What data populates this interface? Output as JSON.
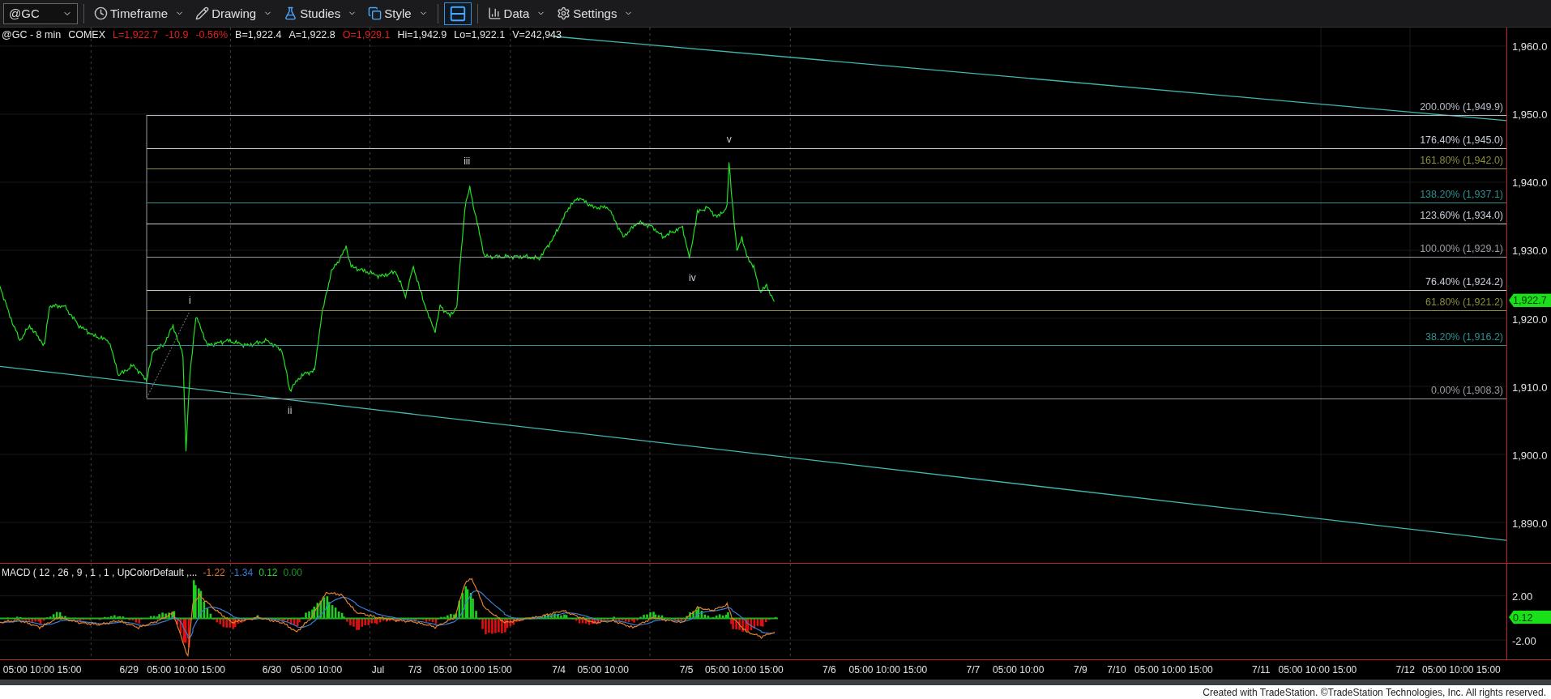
{
  "toolbar": {
    "symbol": "@GC",
    "buttons": [
      {
        "kind": "menu",
        "label": "Timeframe"
      },
      {
        "kind": "menu",
        "label": "Drawing"
      },
      {
        "kind": "menu",
        "label": "Studies"
      },
      {
        "kind": "menu",
        "label": "Style"
      },
      {
        "kind": "toggle"
      },
      {
        "kind": "menu",
        "label": "Data"
      },
      {
        "kind": "menu",
        "label": "Settings"
      }
    ]
  },
  "quote": [
    {
      "text": "@GC - 8 min",
      "color": "#e6e6e6"
    },
    {
      "text": "COMEX",
      "color": "#e6e6e6"
    },
    {
      "text": "L=1,922.7",
      "color": "#e02020"
    },
    {
      "text": "-10.9",
      "color": "#e02020"
    },
    {
      "text": "-0.56%",
      "color": "#e02020"
    },
    {
      "text": "B=1,922.4",
      "color": "#e6e6e6"
    },
    {
      "text": "A=1,922.8",
      "color": "#e6e6e6"
    },
    {
      "text": "O=1,929.1",
      "color": "#e02020"
    },
    {
      "text": "Hi=1,942.9",
      "color": "#e6e6e6"
    },
    {
      "text": "Lo=1,922.1",
      "color": "#e6e6e6"
    },
    {
      "text": "V=242,943",
      "color": "#e6e6e6"
    }
  ],
  "fib_levels": [
    {
      "label": "200.00% (1,949.9)",
      "color": "#b8bcc8"
    },
    {
      "label": "176.40% (1,945.0)",
      "color": "#c8ccd8"
    },
    {
      "label": "161.80% (1,942.0)",
      "color": "#8c8c3c"
    },
    {
      "label": "138.20% (1,937.1)",
      "color": "#2f8f8f"
    },
    {
      "label": "123.60% (1,934.0)",
      "color": "#c8ccd8"
    },
    {
      "label": "100.00% (1,929.1)",
      "color": "#9a9ca4"
    },
    {
      "label": "76.40% (1,924.2)",
      "color": "#c8ccd8"
    },
    {
      "label": "61.80% (1,921.2)",
      "color": "#8c8c3c"
    },
    {
      "label": "38.20% (1,916.2)",
      "color": "#2f8f8f"
    },
    {
      "label": "0.00% (1,908.3)",
      "color": "#9a9ca4"
    }
  ],
  "wave_labels": [
    "i",
    "ii",
    "iii",
    "iv",
    "v"
  ],
  "price_axis": [
    "1,960.0",
    "1,950.0",
    "1,940.0",
    "1,930.0",
    "1,920.0",
    "1,910.0",
    "1,900.0",
    "1,890.0"
  ],
  "last_price": "1,922.7",
  "macd": {
    "label": "MACD ( 12 , 26 , 9 , 1 , 1 , UpColorDefault ,...",
    "values": [
      {
        "text": "-1.22",
        "color": "#e07030"
      },
      {
        "text": "-1.34",
        "color": "#3a7fd5"
      },
      {
        "text": "0.12",
        "color": "#30d030"
      },
      {
        "text": "0.00",
        "color": "#1f9a1f"
      }
    ],
    "axis": [
      "2.00",
      "-2.00"
    ],
    "last_value": "0.12"
  },
  "time_axis": [
    "05:00 10:00 15:00",
    "6/29",
    "05:00 10:00 15:00",
    "6/30",
    "05:00 10:00",
    "Jul",
    "7/3",
    "05:00 10:00 15:00",
    "7/4",
    "05:00 10:00",
    "7/5",
    "05:00 10:00 15:00",
    "7/6",
    "05:00 10:00 15:00",
    "7/7",
    "05:00 10:00",
    "7/9",
    "7/10",
    "05:00 10:00 15:00",
    "7/11",
    "05:00 10:00 15:00",
    "7/12",
    "05:00 10:00 15:00"
  ],
  "footer": "Created with TradeStation. ©TradeStation Technologies, Inc. All rights reserved."
}
